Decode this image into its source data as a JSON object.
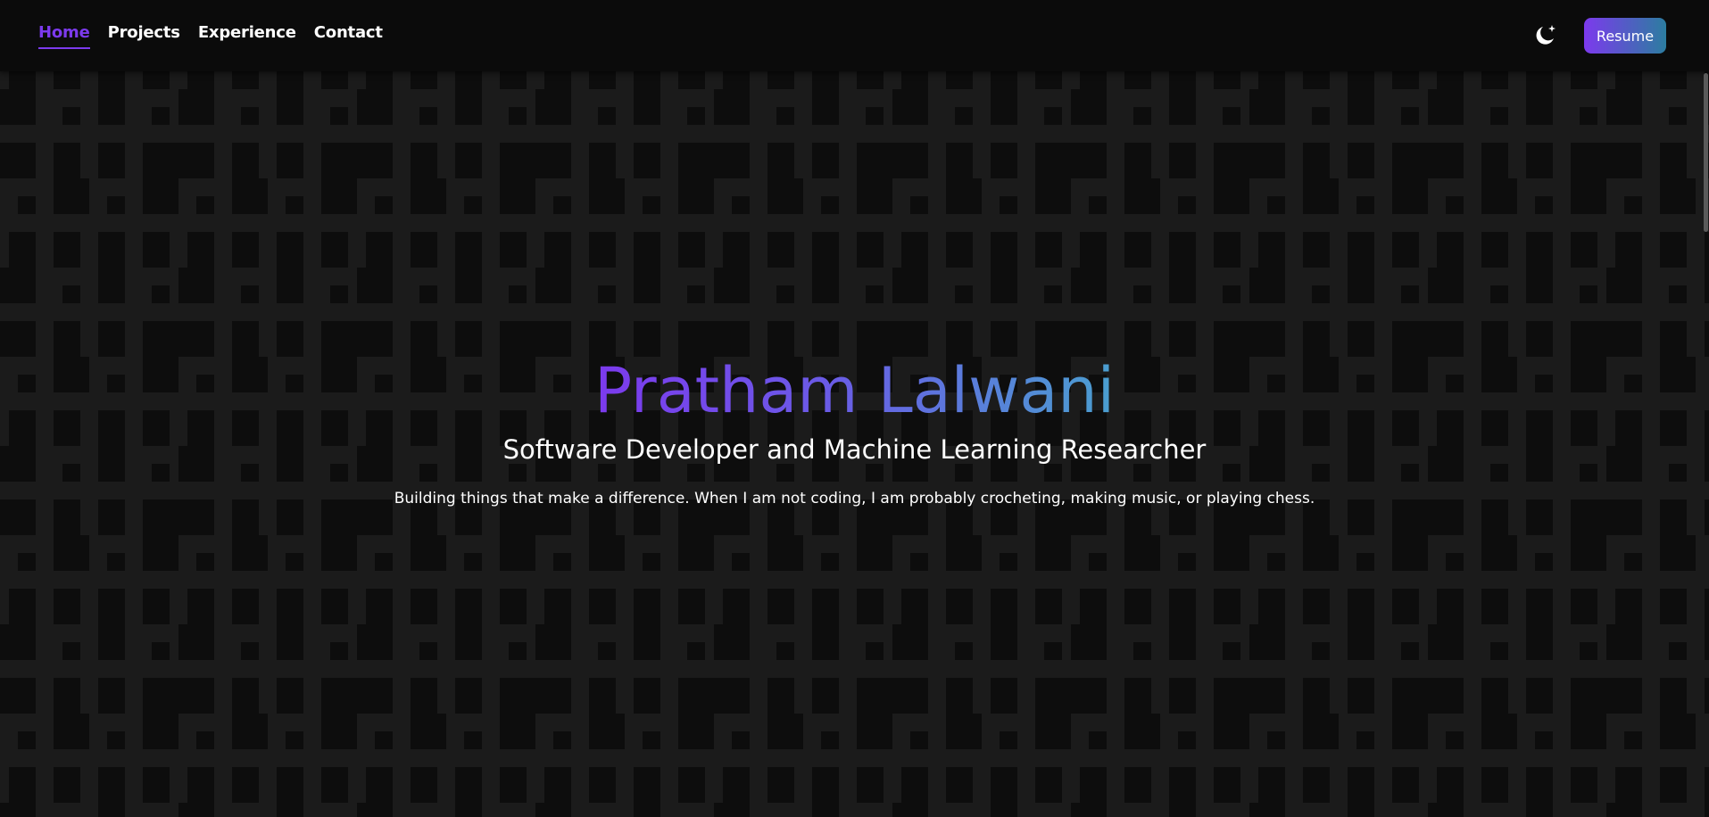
{
  "nav": {
    "items": [
      {
        "label": "Home",
        "active": true
      },
      {
        "label": "Projects",
        "active": false
      },
      {
        "label": "Experience",
        "active": false
      },
      {
        "label": "Contact",
        "active": false
      }
    ]
  },
  "header": {
    "theme_toggle_icon": "moon-sparkle-icon",
    "resume_label": "Resume"
  },
  "hero": {
    "name": "Pratham Lalwani",
    "subtitle": "Software Developer and Machine Learning Researcher",
    "tagline": "Building things that make a difference. When I am not coding, I am probably crocheting, making music, or playing chess."
  },
  "colors": {
    "background": "#0d0d0d",
    "pattern": "#1b1b1b",
    "accent": "#7c3aed",
    "gradient_end": "#4a9fd0",
    "text": "#ffffff"
  }
}
